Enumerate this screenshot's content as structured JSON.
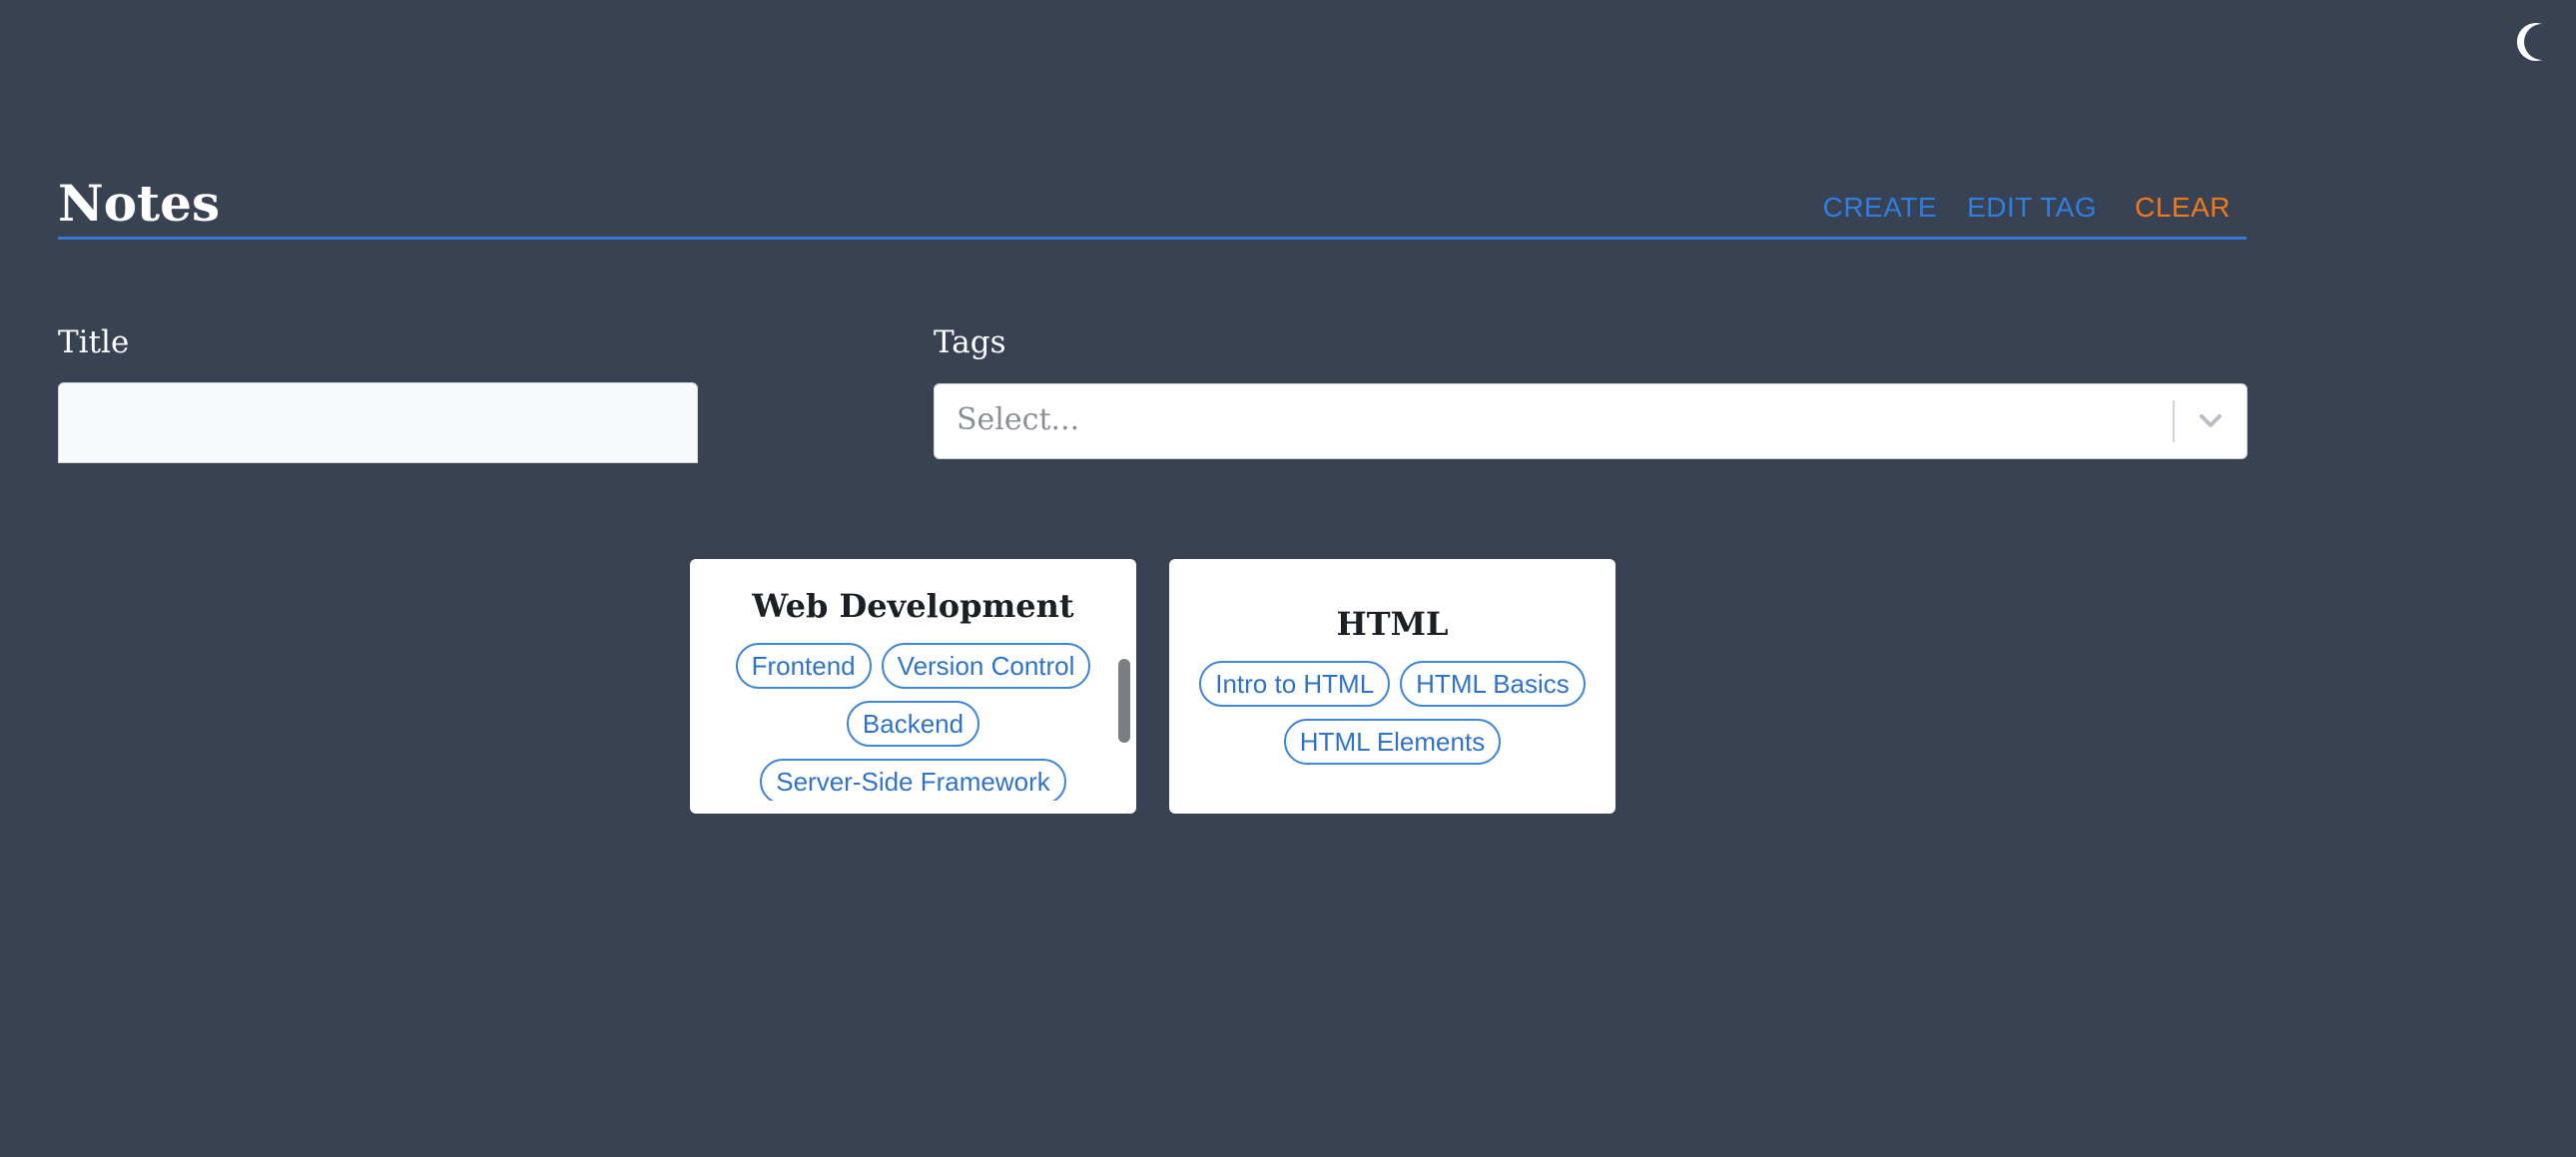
{
  "header": {
    "title": "Notes",
    "actions": {
      "create": "CREATE",
      "edit_tag": "EDIT TAG",
      "clear": "CLEAR"
    }
  },
  "form": {
    "title_label": "Title",
    "title_value": "",
    "tags_label": "Tags",
    "tags_placeholder": "Select..."
  },
  "cards": [
    {
      "title": "Web Development",
      "tags": [
        "Frontend",
        "Version Control",
        "Backend",
        "Server-Side Framework"
      ]
    },
    {
      "title": "HTML",
      "tags": [
        "Intro to HTML",
        "HTML Basics",
        "HTML Elements"
      ]
    }
  ],
  "icons": {
    "theme_toggle": "moon-icon",
    "select_dropdown": "chevron-down-icon"
  },
  "colors": {
    "background": "#394253",
    "accent": "#3578d6",
    "clear": "#f07a1b",
    "tag": "#2f73c9"
  }
}
